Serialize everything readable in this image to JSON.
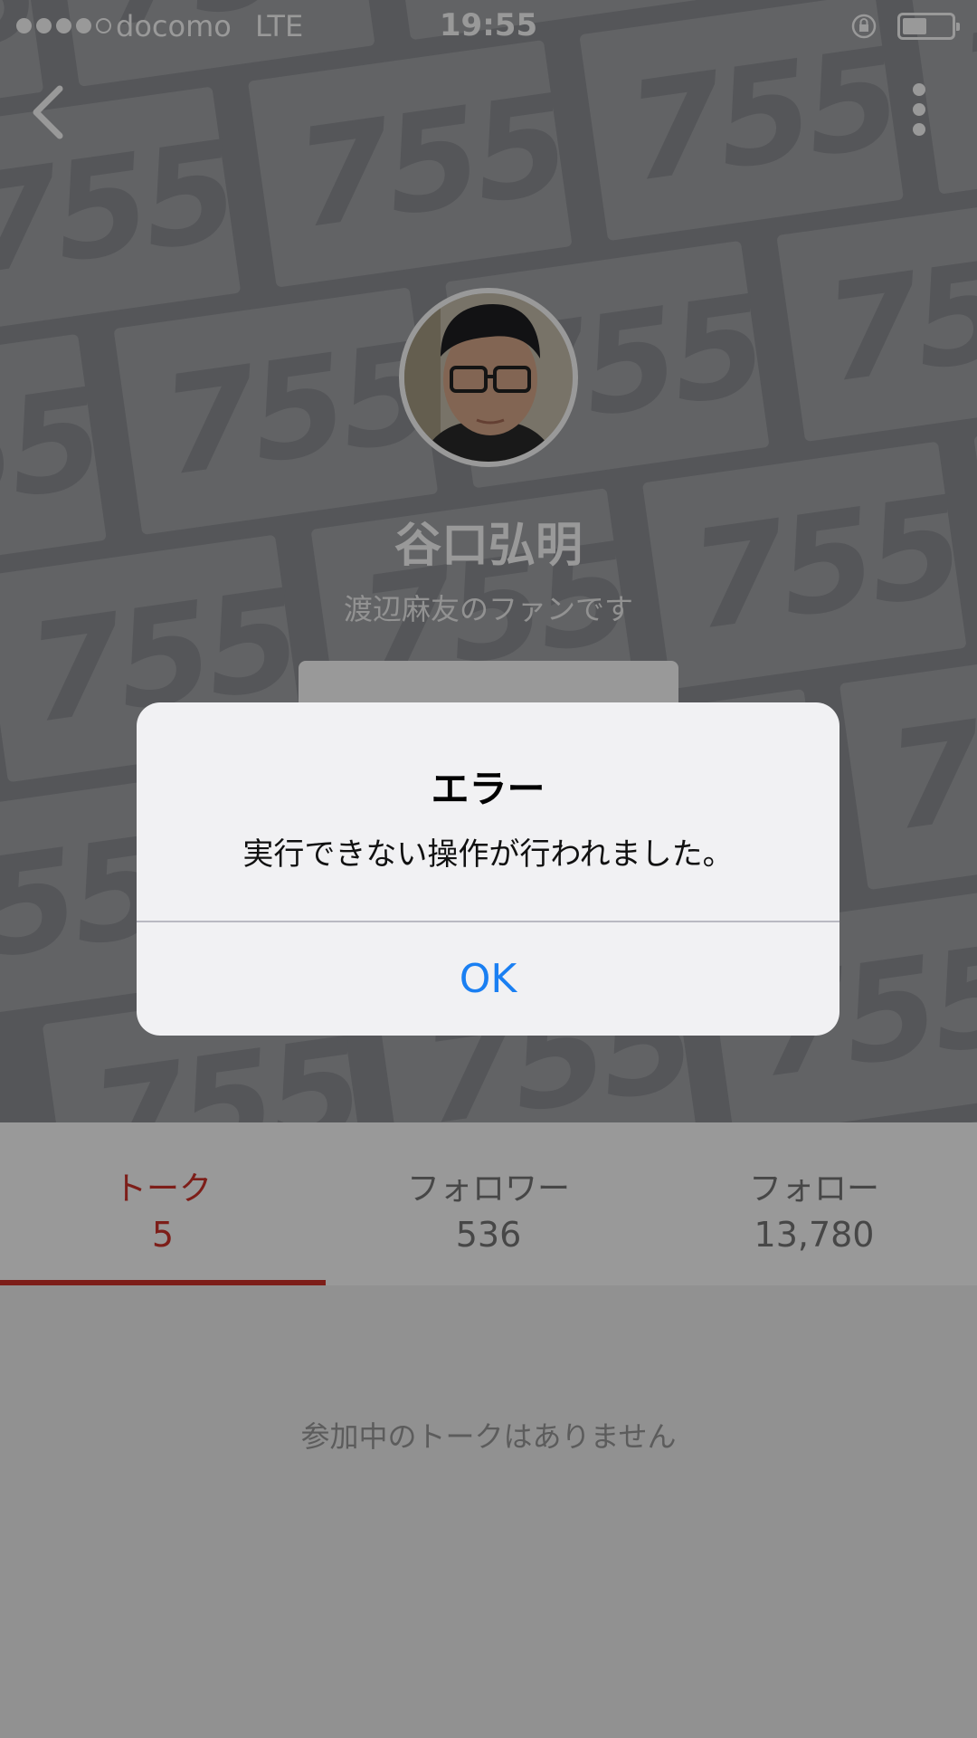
{
  "status_bar": {
    "carrier": "docomo",
    "network": "LTE",
    "time": "19:55",
    "signal_bars_filled": 4,
    "signal_bars_total": 5
  },
  "header": {
    "back_icon": "chevron-left-icon",
    "more_icon": "more-vertical-icon"
  },
  "profile": {
    "name": "谷口弘明",
    "bio": "渡辺麻友のファンです",
    "watermark_text": "755"
  },
  "tabs": [
    {
      "label": "トーク",
      "count": "5",
      "active": true
    },
    {
      "label": "フォロワー",
      "count": "536",
      "active": false
    },
    {
      "label": "フォロー",
      "count": "13,780",
      "active": false
    }
  ],
  "empty_message": "参加中のトークはありません",
  "alert": {
    "title": "エラー",
    "message": "実行できない操作が行われました。",
    "ok_label": "OK"
  },
  "colors": {
    "accent": "#d0322a",
    "link": "#1a7ff2"
  }
}
